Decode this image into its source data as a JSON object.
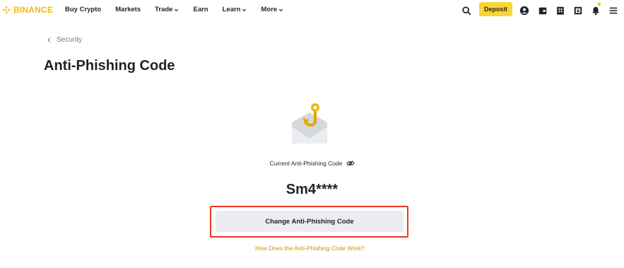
{
  "brand": {
    "name": "BINANCE",
    "color": "#f0b90b"
  },
  "nav": {
    "items": [
      {
        "label": "Buy Crypto",
        "has_dropdown": false
      },
      {
        "label": "Markets",
        "has_dropdown": false
      },
      {
        "label": "Trade",
        "has_dropdown": true
      },
      {
        "label": "Earn",
        "has_dropdown": false
      },
      {
        "label": "Learn",
        "has_dropdown": true
      },
      {
        "label": "More",
        "has_dropdown": true
      }
    ],
    "deposit_label": "Deposit",
    "icons": [
      "search-icon",
      "user-icon",
      "wallet-icon",
      "orders-icon",
      "download-icon",
      "notification-bell-icon",
      "menu-icon"
    ]
  },
  "breadcrumb": {
    "label": "Security"
  },
  "page": {
    "title": "Anti-Phishing Code",
    "current_code_label": "Current Anti-Phishing Code",
    "current_code_value": "Sm4****",
    "change_button_label": "Change Anti-Phishing Code",
    "help_link_label": "How Does the Anti-Phishing Code Work?"
  },
  "colors": {
    "accent": "#fcd535",
    "link": "#c99400",
    "highlight": "#e8381f",
    "button_bg": "#eaecef"
  }
}
